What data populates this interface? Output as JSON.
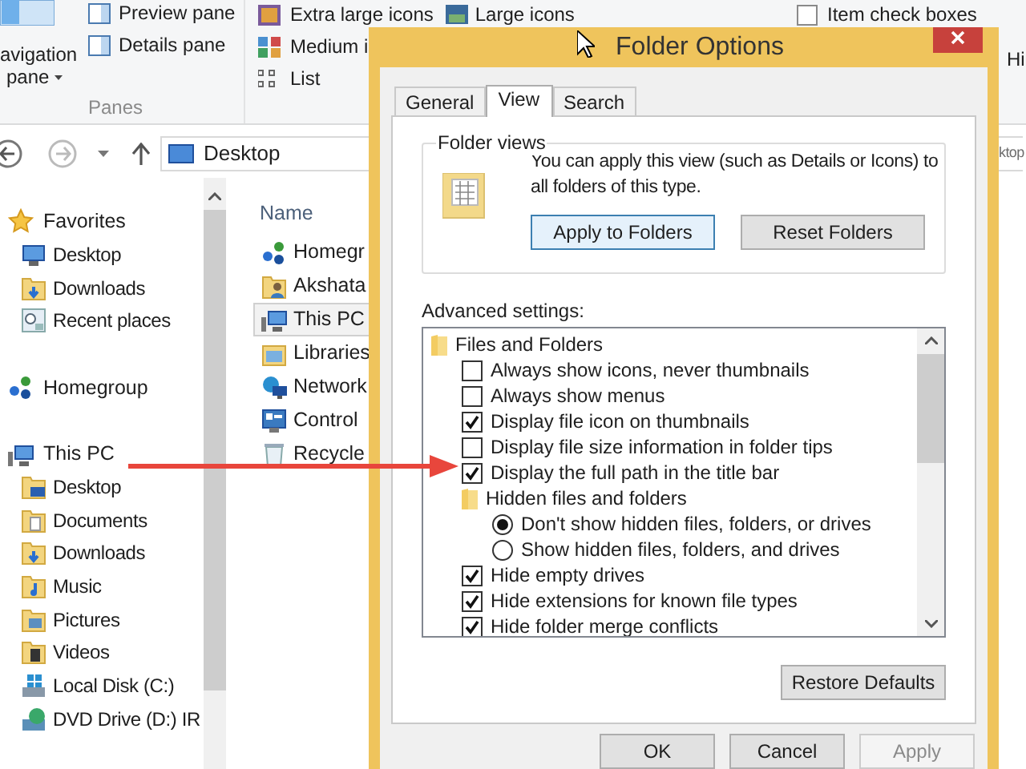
{
  "ribbon": {
    "panes_group": {
      "navigation_pane": {
        "line_1": "avigation",
        "line_2": "pane"
      },
      "items": [
        "Preview pane",
        "Details pane"
      ],
      "label": "Panes"
    },
    "layout_items": [
      {
        "label": "Extra large icons",
        "kind": "xl"
      },
      {
        "label": "Medium i",
        "kind": "medium"
      },
      {
        "label": "List",
        "kind": "list"
      }
    ],
    "large_icons": "Large icons",
    "item_check_boxes": {
      "label": "Item check boxes",
      "checked": false
    },
    "hide_label": "Hi"
  },
  "address_bar": {
    "path": "Desktop"
  },
  "search_field": {
    "placeholder": "ktop"
  },
  "navigation_pane": [
    {
      "label": "Favorites",
      "kind": "favorites",
      "children": [
        {
          "label": "Desktop",
          "kind": "desktop"
        },
        {
          "label": "Downloads",
          "kind": "downloads"
        },
        {
          "label": "Recent places",
          "kind": "recent"
        }
      ]
    },
    {
      "label": "Homegroup",
      "kind": "homegroup"
    },
    {
      "label": "This PC",
      "kind": "pc",
      "children": [
        {
          "label": "Desktop",
          "kind": "folder_desktop"
        },
        {
          "label": "Documents",
          "kind": "documents"
        },
        {
          "label": "Downloads",
          "kind": "downloads"
        },
        {
          "label": "Music",
          "kind": "music"
        },
        {
          "label": "Pictures",
          "kind": "pictures"
        },
        {
          "label": "Videos",
          "kind": "videos"
        },
        {
          "label": "Local Disk (C:)",
          "kind": "disk"
        },
        {
          "label": "DVD Drive (D:) IR",
          "kind": "dvd"
        }
      ]
    }
  ],
  "file_list": {
    "column": "Name",
    "items": [
      {
        "name": "Homegr",
        "kind": "homegroup",
        "selected": false
      },
      {
        "name": "Akshata",
        "kind": "user",
        "selected": false
      },
      {
        "name": "This PC",
        "kind": "pc",
        "selected": true
      },
      {
        "name": "Libraries",
        "kind": "libraries",
        "selected": false
      },
      {
        "name": "Network",
        "kind": "network",
        "selected": false
      },
      {
        "name": "Control",
        "kind": "control_panel",
        "selected": false
      },
      {
        "name": "Recycle",
        "kind": "recycle_bin",
        "selected": false
      }
    ]
  },
  "dialog": {
    "title": "Folder Options",
    "tabs": [
      {
        "label": "General",
        "selected": false
      },
      {
        "label": "View",
        "selected": true
      },
      {
        "label": "Search",
        "selected": false
      }
    ],
    "folder_views": {
      "title": "Folder views",
      "description": "You can apply this view (such as Details or Icons) to all folders of this type.",
      "buttons": [
        {
          "label": "Apply to Folders",
          "focused": true
        },
        {
          "label": "Reset Folders",
          "focused": false
        }
      ]
    },
    "advanced_label": "Advanced settings:",
    "advanced_settings": [
      {
        "kind": "folder",
        "label": "Files and Folders",
        "children": [
          {
            "kind": "checkbox",
            "label": "Always show icons, never thumbnails",
            "checked": false
          },
          {
            "kind": "checkbox",
            "label": "Always show menus",
            "checked": false
          },
          {
            "kind": "checkbox",
            "label": "Display file icon on thumbnails",
            "checked": true
          },
          {
            "kind": "checkbox",
            "label": "Display file size information in folder tips",
            "checked": false
          },
          {
            "kind": "checkbox",
            "label": "Display the full path in the title bar",
            "checked": true
          },
          {
            "kind": "folder",
            "label": "Hidden files and folders",
            "children": [
              {
                "kind": "radio",
                "label": "Don't show hidden files, folders, or drives",
                "selected": true
              },
              {
                "kind": "radio",
                "label": "Show hidden files, folders, and drives",
                "selected": false
              }
            ]
          },
          {
            "kind": "checkbox",
            "label": "Hide empty drives",
            "checked": true
          },
          {
            "kind": "checkbox",
            "label": "Hide extensions for known file types",
            "checked": true
          },
          {
            "kind": "checkbox",
            "label": "Hide folder merge conflicts",
            "checked": true
          }
        ]
      }
    ],
    "restore_button": "Restore Defaults",
    "buttons": [
      {
        "label": "OK",
        "disabled": false
      },
      {
        "label": "Cancel",
        "disabled": false
      },
      {
        "label": "Apply",
        "disabled": true
      }
    ]
  }
}
